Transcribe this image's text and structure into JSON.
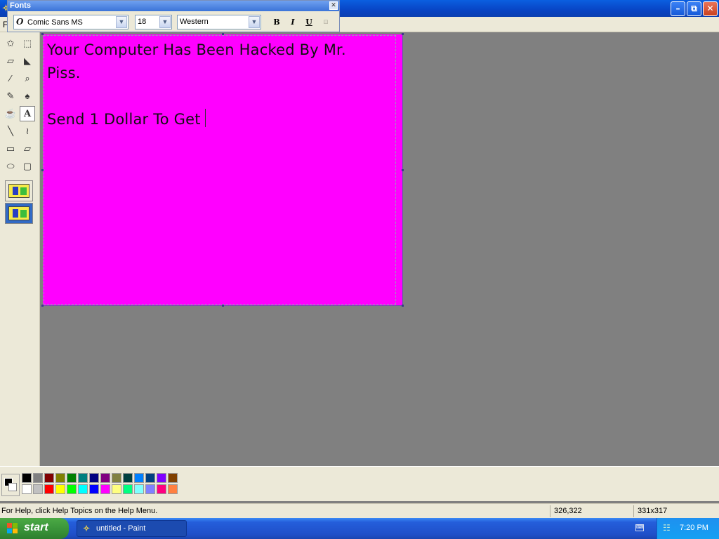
{
  "window": {
    "min_glyph": "–",
    "max_glyph": "⧉",
    "close_glyph": "✕"
  },
  "menubar": {
    "first_item": "F"
  },
  "fonts_toolbar": {
    "title": "Fonts",
    "close_glyph": "✕",
    "font_name": "Comic Sans MS",
    "font_size": "18",
    "script": "Western",
    "bold": "B",
    "italic": "I",
    "underline": "U",
    "vertical": "⊟"
  },
  "tools": [
    {
      "name": "free-form-select-icon",
      "glyph": "✩"
    },
    {
      "name": "rect-select-icon",
      "glyph": "⬚"
    },
    {
      "name": "eraser-icon",
      "glyph": "▱"
    },
    {
      "name": "fill-icon",
      "glyph": "◣"
    },
    {
      "name": "color-picker-icon",
      "glyph": "∕"
    },
    {
      "name": "magnifier-icon",
      "glyph": "⌕"
    },
    {
      "name": "pencil-icon",
      "glyph": "✎"
    },
    {
      "name": "brush-icon",
      "glyph": "♠"
    },
    {
      "name": "airbrush-icon",
      "glyph": "☕"
    },
    {
      "name": "text-icon",
      "glyph": "A"
    },
    {
      "name": "line-icon",
      "glyph": "╲"
    },
    {
      "name": "curve-icon",
      "glyph": "≀"
    },
    {
      "name": "rectangle-icon",
      "glyph": "▭"
    },
    {
      "name": "polygon-icon",
      "glyph": "▱"
    },
    {
      "name": "ellipse-icon",
      "glyph": "⬭"
    },
    {
      "name": "rounded-rect-icon",
      "glyph": "▢"
    }
  ],
  "canvas": {
    "background": "#ff00ff",
    "line1": "Your Computer Has Been Hacked By Mr.",
    "line2": "Piss.",
    "line3": "Send 1 Dollar To Get"
  },
  "palette_top": [
    "#000000",
    "#808080",
    "#800000",
    "#808000",
    "#008000",
    "#008080",
    "#000080",
    "#800080",
    "#808040",
    "#004040",
    "#0080ff",
    "#004080",
    "#8000ff",
    "#804000"
  ],
  "palette_bottom": [
    "#ffffff",
    "#c0c0c0",
    "#ff0000",
    "#ffff00",
    "#00ff00",
    "#00ffff",
    "#0000ff",
    "#ff00ff",
    "#ffff80",
    "#00ff80",
    "#80ffff",
    "#8080ff",
    "#ff0080",
    "#ff8040"
  ],
  "statusbar": {
    "help": "For Help, click Help Topics on the Help Menu.",
    "coords": "326,322",
    "size": "331x317"
  },
  "taskbar": {
    "start": "start",
    "task": "untitled - Paint",
    "clock": "7:20 PM"
  }
}
